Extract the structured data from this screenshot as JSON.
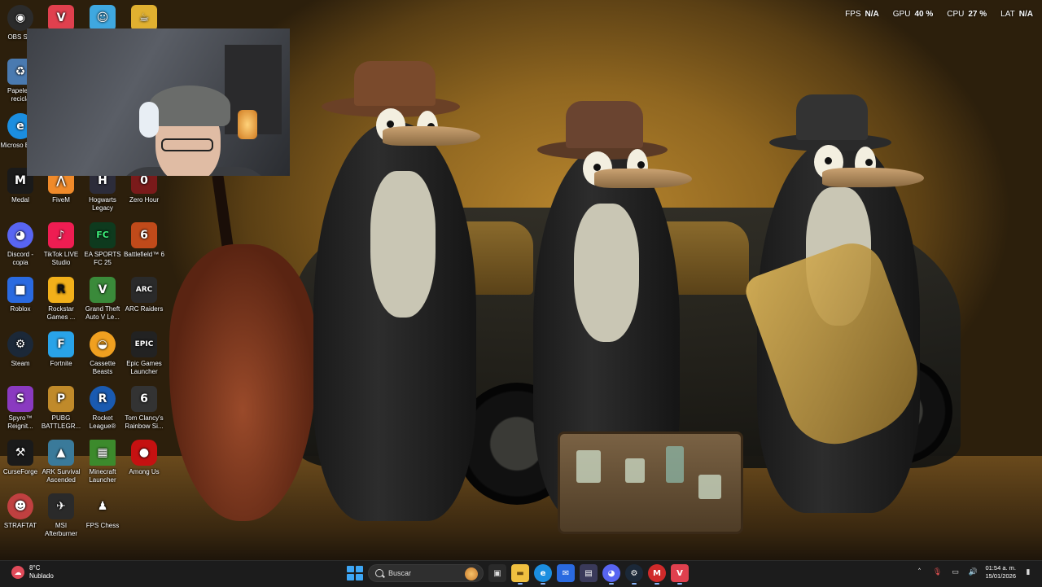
{
  "hud": {
    "fps_label": "FPS",
    "fps_value": "N/A",
    "gpu_label": "GPU",
    "gpu_value": "40 %",
    "cpu_label": "CPU",
    "cpu_value": "27 %",
    "lat_label": "LAT",
    "lat_value": "N/A"
  },
  "desktop_icons": {
    "obs": {
      "label": "OBS Stu",
      "icon": "obs-icon",
      "color": "#2b2b2b"
    },
    "valorant": {
      "label": "",
      "icon": "valorant-icon",
      "color": "#e0404e"
    },
    "game_blue": {
      "label": "",
      "icon": "game-character-icon",
      "color": "#3fa8e0"
    },
    "cuphead": {
      "label": "",
      "icon": "cuphead-icon",
      "color": "#e0b030"
    },
    "recycle": {
      "label": "Papelera recicla",
      "icon": "recycle-bin-icon",
      "color": "#4a7ab0"
    },
    "edge": {
      "label": "Microso Edge",
      "icon": "edge-icon",
      "color": "#1b8ee0"
    },
    "medal": {
      "label": "Medal",
      "icon": "medal-icon",
      "color": "#1a1a1a"
    },
    "fivem": {
      "label": "FiveM",
      "icon": "fivem-icon",
      "color": "#f08a2a"
    },
    "hogwarts": {
      "label": "Hogwarts Legacy",
      "icon": "hogwarts-icon",
      "color": "#2c2c3a"
    },
    "zero_hour": {
      "label": "Zero Hour",
      "icon": "zero-hour-icon",
      "color": "#7a1a1a"
    },
    "discord": {
      "label": "Discord - copia",
      "icon": "discord-icon",
      "color": "#5865f2"
    },
    "tiktok": {
      "label": "TikTok LIVE Studio",
      "icon": "tiktok-icon",
      "color": "#ee1d52"
    },
    "eafc": {
      "label": "EA SPORTS FC 25",
      "icon": "ea-fc-icon",
      "color": "#0e3a1e"
    },
    "battlefield": {
      "label": "Battlefield™ 6",
      "icon": "battlefield-icon",
      "color": "#c04a1a"
    },
    "roblox": {
      "label": "Roblox",
      "icon": "roblox-icon",
      "color": "#2a6ae0"
    },
    "rockstar": {
      "label": "Rockstar Games ...",
      "icon": "rockstar-icon",
      "color": "#f2b01a"
    },
    "gta": {
      "label": "Grand Theft Auto V Le...",
      "icon": "gta-icon",
      "color": "#3a8a3a"
    },
    "arc": {
      "label": "ARC Raiders",
      "icon": "arc-raiders-icon",
      "color": "#2a2a2a"
    },
    "steam": {
      "label": "Steam",
      "icon": "steam-icon",
      "color": "#1b2838"
    },
    "fortnite": {
      "label": "Fortnite",
      "icon": "fortnite-icon",
      "color": "#29a3e8"
    },
    "cassette": {
      "label": "Cassette Beasts",
      "icon": "cassette-beasts-icon",
      "color": "#f0a020"
    },
    "epic": {
      "label": "Epic Games Launcher",
      "icon": "epic-games-icon",
      "color": "#222"
    },
    "spyro": {
      "label": "Spyro™ Reignit...",
      "icon": "spyro-icon",
      "color": "#8a3ac0"
    },
    "pubg": {
      "label": "PUBG BATTLEGR...",
      "icon": "pubg-icon",
      "color": "#c08a2a"
    },
    "rocket": {
      "label": "Rocket League®",
      "icon": "rocket-league-icon",
      "color": "#1a5ab0"
    },
    "rainbow": {
      "label": "Tom Clancy's Rainbow Si...",
      "icon": "rainbow-six-icon",
      "color": "#333"
    },
    "curseforge": {
      "label": "CurseForge",
      "icon": "curseforge-icon",
      "color": "#1a1a1a"
    },
    "ark": {
      "label": "ARK Survival Ascended",
      "icon": "ark-icon",
      "color": "#3a7a9a"
    },
    "minecraft": {
      "label": "Minecraft Launcher",
      "icon": "minecraft-icon",
      "color": "#3c8a2c"
    },
    "among": {
      "label": "Among Us",
      "icon": "among-us-icon",
      "color": "#c51111"
    },
    "strafttat": {
      "label": "STRAFTAT",
      "icon": "strafttat-icon",
      "color": "#c04040"
    },
    "msi": {
      "label": "MSI Afterburner",
      "icon": "msi-afterburner-icon",
      "color": "#2a2a2a"
    },
    "fpschess": {
      "label": "FPS Chess",
      "icon": "fps-chess-icon",
      "color": "#eeeeee"
    }
  },
  "taskbar": {
    "weather_temp": "8°C",
    "weather_desc": "Nublado",
    "search_placeholder": "Buscar",
    "time": "01:54 a. m.",
    "date": "15/01/2026",
    "apps": [
      {
        "name": "task-view",
        "color": "#3a3a3a"
      },
      {
        "name": "file-explorer",
        "color": "#f0c040"
      },
      {
        "name": "edge",
        "color": "#1b8ee0"
      },
      {
        "name": "outlook",
        "color": "#2a6ae0"
      },
      {
        "name": "microsoft-store",
        "color": "#3a3a5a"
      },
      {
        "name": "discord",
        "color": "#5865f2"
      },
      {
        "name": "steam",
        "color": "#1b2838"
      },
      {
        "name": "medal",
        "color": "#d02a2a"
      },
      {
        "name": "valorant",
        "color": "#e0404e"
      }
    ]
  }
}
